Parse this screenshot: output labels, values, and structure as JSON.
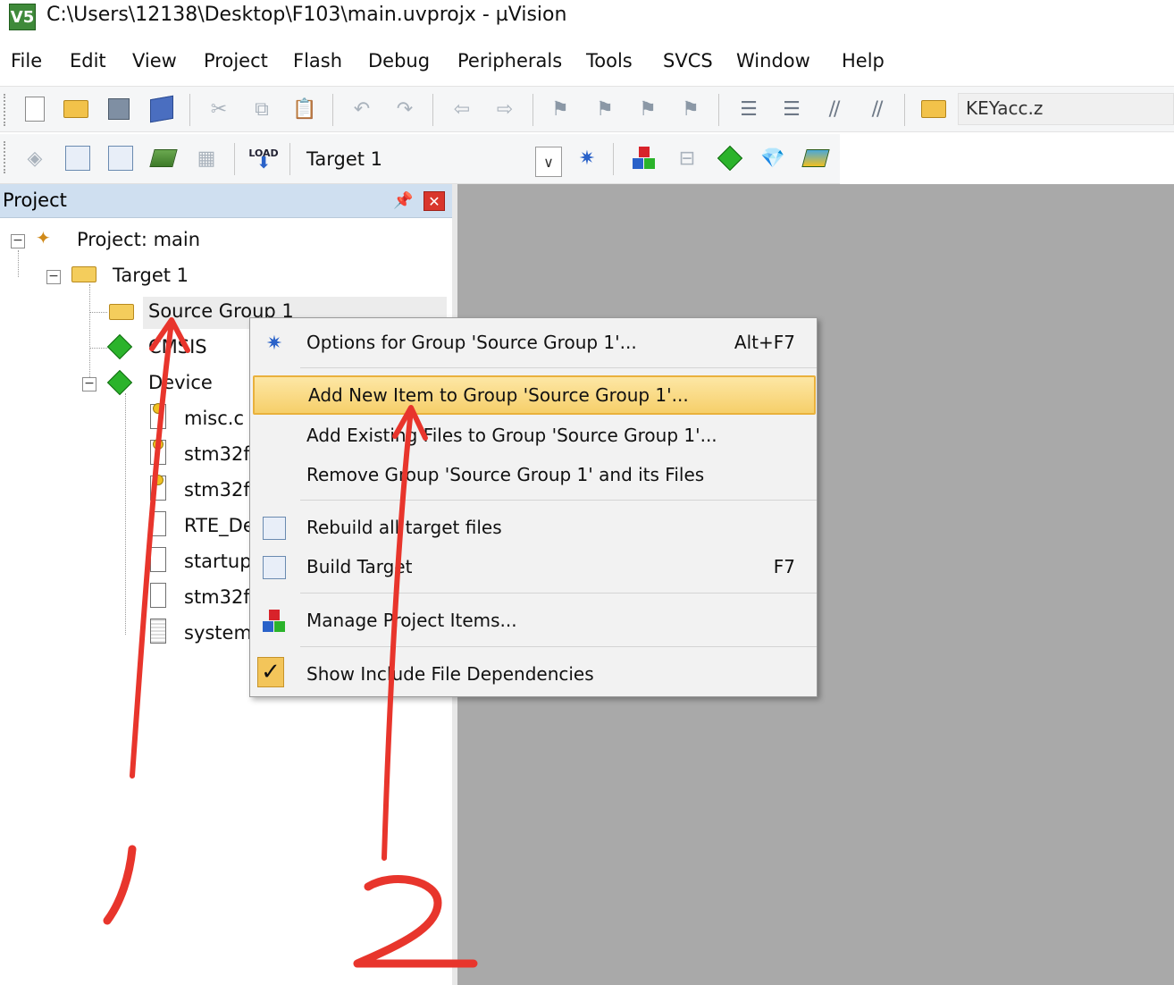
{
  "window": {
    "title": "C:\\Users\\12138\\Desktop\\F103\\main.uvprojx - µVision",
    "logo_text": "V5"
  },
  "menubar": {
    "items": [
      "File",
      "Edit",
      "View",
      "Project",
      "Flash",
      "Debug",
      "Peripherals",
      "Tools",
      "SVCS",
      "Window",
      "Help"
    ]
  },
  "toolbar": {
    "search_value": "KEYacc.z",
    "target_name": "Target 1",
    "load_label": "LOAD"
  },
  "project_pane": {
    "title": "Project",
    "tree": {
      "project": "Project: main",
      "target": "Target 1",
      "group": "Source Group 1",
      "cmsis": "CMSIS",
      "device": "Device",
      "files": [
        "misc.c",
        "stm32f",
        "stm32f",
        "RTE_De",
        "startup",
        "stm32f",
        "system"
      ]
    }
  },
  "context_menu": {
    "items": [
      {
        "label": "Options for Group 'Source Group 1'...",
        "shortcut": "Alt+F7",
        "icon": "options-wand-icon"
      },
      {
        "label": "Add New  Item to Group 'Source Group 1'...",
        "shortcut": "",
        "icon": "",
        "highlighted": true
      },
      {
        "label": "Add Existing Files to Group 'Source Group 1'...",
        "shortcut": "",
        "icon": ""
      },
      {
        "label": "Remove Group 'Source Group 1' and its Files",
        "shortcut": "",
        "icon": ""
      },
      {
        "label": "Rebuild all target files",
        "shortcut": "",
        "icon": "rebuild-icon"
      },
      {
        "label": "Build Target",
        "shortcut": "F7",
        "icon": "build-icon"
      },
      {
        "label": "Manage Project Items...",
        "shortcut": "",
        "icon": "manage-items-icon"
      },
      {
        "label": "Show Include File Dependencies",
        "shortcut": "",
        "icon": "checkmark-icon",
        "checked": true
      }
    ]
  },
  "annotations": {
    "mark_1": "1",
    "mark_2": "2",
    "color": "#e8352c"
  },
  "colors": {
    "highlight": "#f6cf6a",
    "pane_header": "#cfdff0",
    "editor_bg": "#a9a9a9",
    "close_red": "#d9362c"
  }
}
